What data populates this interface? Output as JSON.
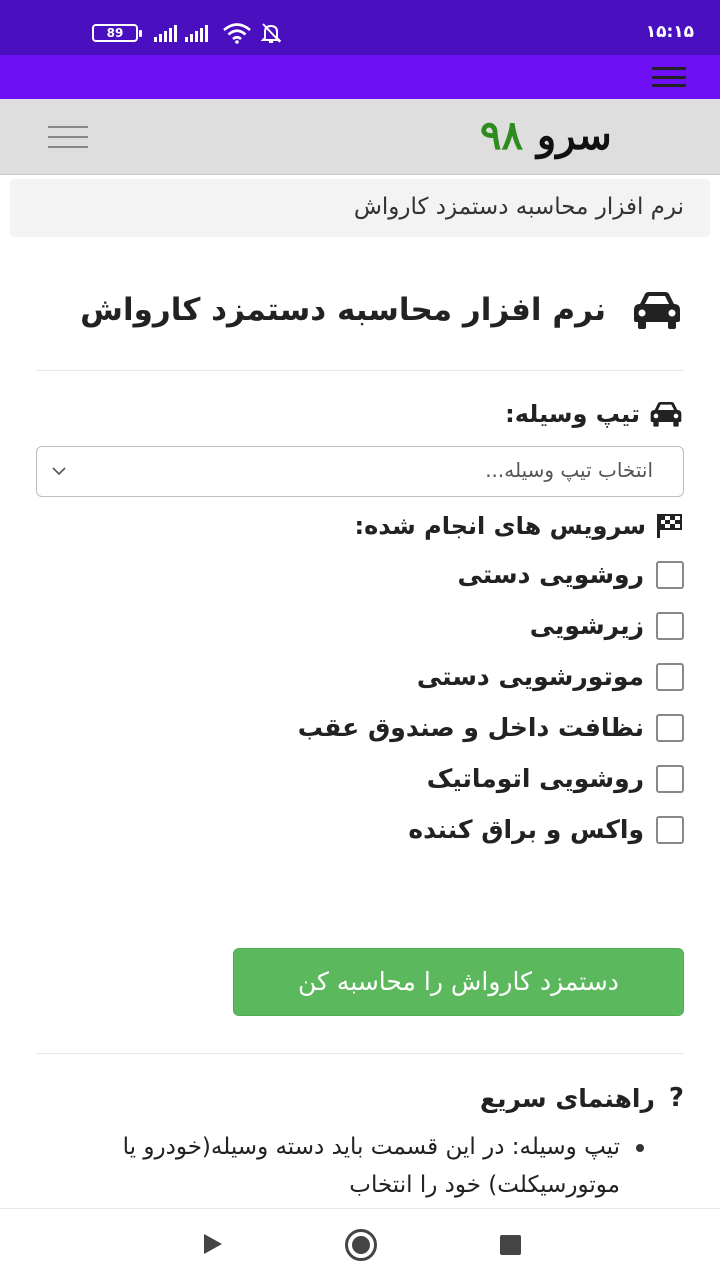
{
  "status_bar": {
    "time": "۱۵:۱۵",
    "battery": "89",
    "icons": [
      "battery-icon",
      "signal-icon",
      "signal-icon",
      "wifi-icon",
      "bell-off-icon"
    ]
  },
  "site": {
    "logo_word1": "سرو",
    "logo_word2": "۹۸",
    "logo_color_primary": "#111111",
    "logo_color_accent": "#2e8b1e"
  },
  "breadcrumb": "نرم افزار محاسبه دستمزد کارواش",
  "page_title": "نرم افزار محاسبه دستمزد کارواش",
  "vehicle": {
    "label": "تیپ وسیله:",
    "select_value": "انتخاب تیپ وسیله..."
  },
  "services": {
    "label": "سرویس های انجام شده:",
    "items": [
      {
        "label": "روشویی دستی",
        "checked": false
      },
      {
        "label": "زیرشویی",
        "checked": false
      },
      {
        "label": "موتورشویی دستی",
        "checked": false
      },
      {
        "label": "نظافت داخل و صندوق عقب",
        "checked": false
      },
      {
        "label": "روشویی اتوماتیک",
        "checked": false
      },
      {
        "label": "واکس و براق کننده",
        "checked": false
      }
    ]
  },
  "calculate_button": "دستمزد کارواش را محاسبه کن",
  "guide": {
    "title": "راهنمای سریع",
    "item1": "تیپ وسیله: در این قسمت باید دسته وسیله(خودرو یا موتورسیکلت) خود را انتخاب"
  },
  "colors": {
    "status_bar": "#4a0fbf",
    "top_bar": "#6f0ff4",
    "button": "#5cb85c"
  }
}
